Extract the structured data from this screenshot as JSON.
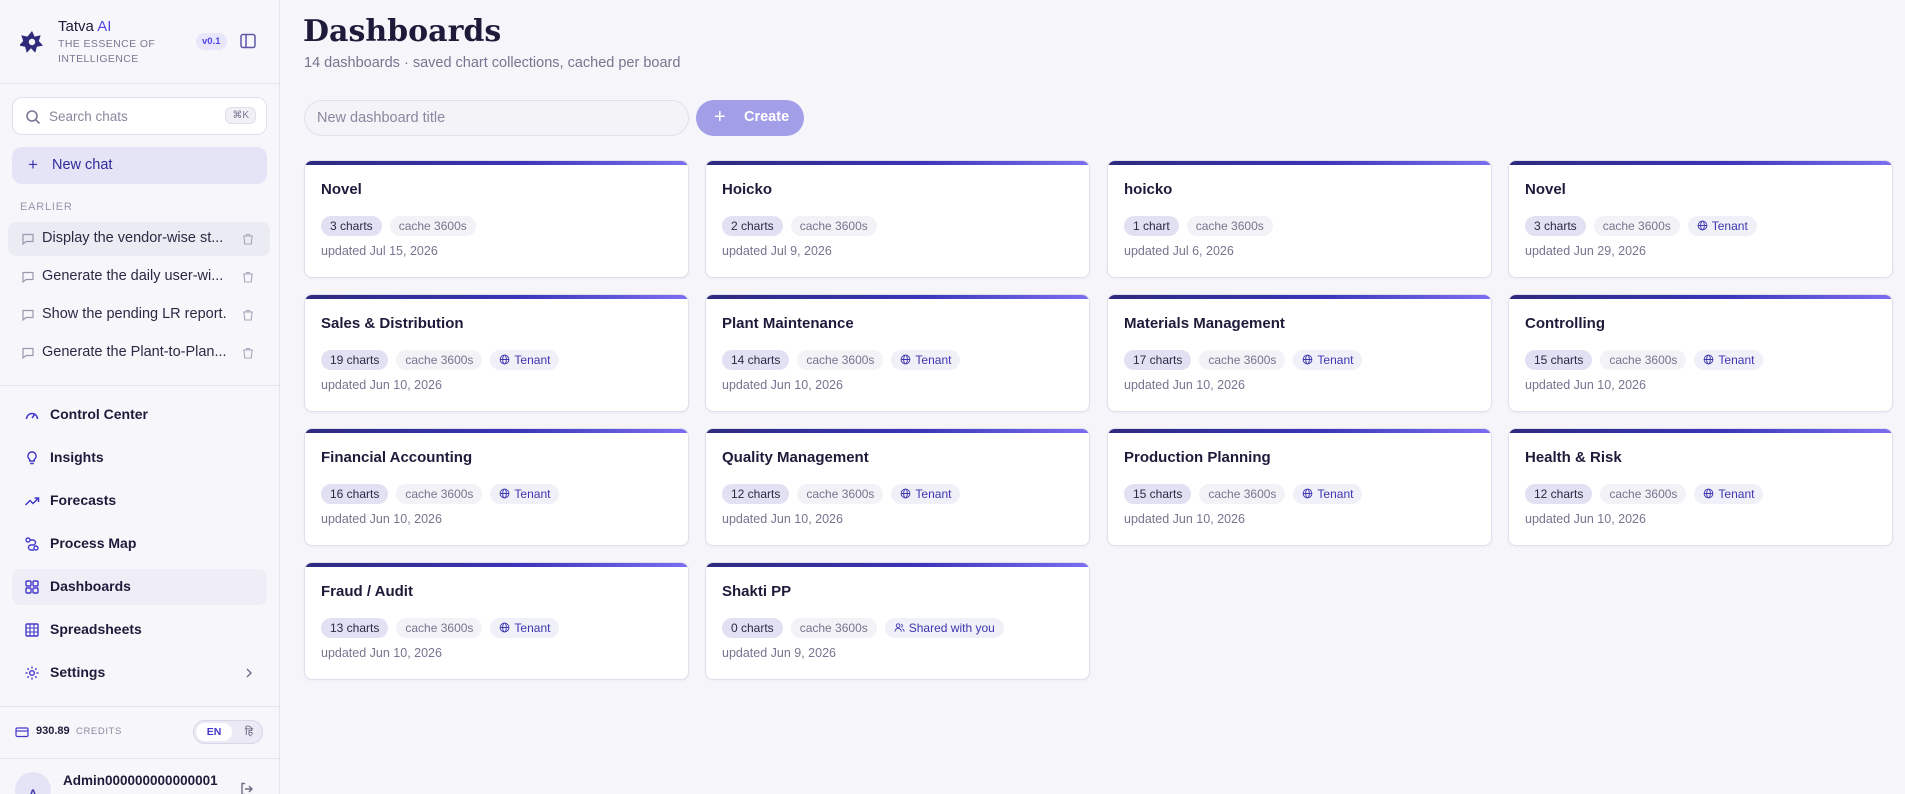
{
  "brand": {
    "name": "Tatva",
    "ai": "AI",
    "tagline": "THE ESSENCE OF INTELLIGENCE",
    "version": "v0.1"
  },
  "search": {
    "label": "Search chats",
    "shortcut": "⌘K"
  },
  "new_chat_label": "New chat",
  "earlier_label": "EARLIER",
  "chats": [
    "Display the vendor-wise st...",
    "Generate the daily user-wi...",
    "Show the pending LR report.",
    "Generate the Plant-to-Plan..."
  ],
  "nav": [
    {
      "label": "Control Center",
      "icon": "gauge-icon"
    },
    {
      "label": "Insights",
      "icon": "lightbulb-icon"
    },
    {
      "label": "Forecasts",
      "icon": "trend-icon"
    },
    {
      "label": "Process Map",
      "icon": "route-icon"
    },
    {
      "label": "Dashboards",
      "icon": "grid-icon"
    },
    {
      "label": "Spreadsheets",
      "icon": "table-icon"
    },
    {
      "label": "Settings",
      "icon": "gear-icon"
    }
  ],
  "credits": {
    "value": "930.89",
    "label": "CREDITS"
  },
  "language": {
    "en": "EN",
    "alt": "हि"
  },
  "user": {
    "initial": "A",
    "name": "Admin000000000000001"
  },
  "page": {
    "title": "Dashboards",
    "subtitle": "14 dashboards · saved chart collections, cached per board",
    "input_placeholder": "New dashboard title",
    "create_label": "Create"
  },
  "dashboards": [
    {
      "title": "Novel",
      "charts": "3 charts",
      "cache": "cache 3600s",
      "scope": "",
      "updated": "updated Jul 15, 2026"
    },
    {
      "title": "Hoicko",
      "charts": "2 charts",
      "cache": "cache 3600s",
      "scope": "",
      "updated": "updated Jul 9, 2026"
    },
    {
      "title": "hoicko",
      "charts": "1 chart",
      "cache": "cache 3600s",
      "scope": "",
      "updated": "updated Jul 6, 2026"
    },
    {
      "title": "Novel",
      "charts": "3 charts",
      "cache": "cache 3600s",
      "scope": "Tenant",
      "updated": "updated Jun 29, 2026"
    },
    {
      "title": "Sales & Distribution",
      "charts": "19 charts",
      "cache": "cache 3600s",
      "scope": "Tenant",
      "updated": "updated Jun 10, 2026"
    },
    {
      "title": "Plant Maintenance",
      "charts": "14 charts",
      "cache": "cache 3600s",
      "scope": "Tenant",
      "updated": "updated Jun 10, 2026"
    },
    {
      "title": "Materials Management",
      "charts": "17 charts",
      "cache": "cache 3600s",
      "scope": "Tenant",
      "updated": "updated Jun 10, 2026"
    },
    {
      "title": "Controlling",
      "charts": "15 charts",
      "cache": "cache 3600s",
      "scope": "Tenant",
      "updated": "updated Jun 10, 2026"
    },
    {
      "title": "Financial Accounting",
      "charts": "16 charts",
      "cache": "cache 3600s",
      "scope": "Tenant",
      "updated": "updated Jun 10, 2026"
    },
    {
      "title": "Quality Management",
      "charts": "12 charts",
      "cache": "cache 3600s",
      "scope": "Tenant",
      "updated": "updated Jun 10, 2026"
    },
    {
      "title": "Production Planning",
      "charts": "15 charts",
      "cache": "cache 3600s",
      "scope": "Tenant",
      "updated": "updated Jun 10, 2026"
    },
    {
      "title": "Health & Risk",
      "charts": "12 charts",
      "cache": "cache 3600s",
      "scope": "Tenant",
      "updated": "updated Jun 10, 2026"
    },
    {
      "title": "Fraud / Audit",
      "charts": "13 charts",
      "cache": "cache 3600s",
      "scope": "Tenant",
      "updated": "updated Jun 10, 2026"
    },
    {
      "title": "Shakti PP",
      "charts": "0 charts",
      "cache": "cache 3600s",
      "scope": "Shared with you",
      "updated": "updated Jun 9, 2026"
    }
  ]
}
